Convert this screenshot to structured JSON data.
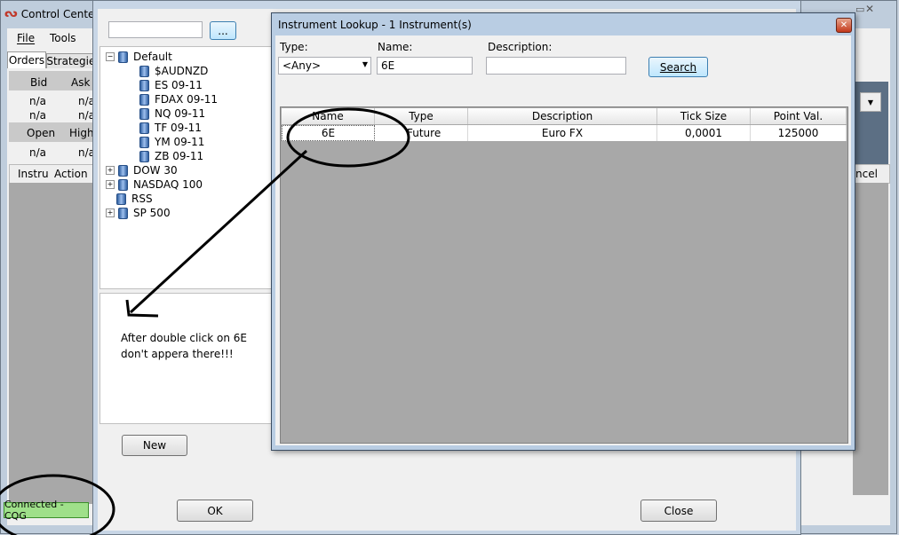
{
  "control_center": {
    "title": "Control Center",
    "menu": {
      "file": "File",
      "tools": "Tools"
    },
    "tabs": [
      "Orders",
      "Strategies"
    ],
    "quote_headers": [
      "Bid",
      "Ask"
    ],
    "quote_rows": [
      [
        "n/a",
        "n/a"
      ],
      [
        "n/a",
        "n/a"
      ]
    ],
    "quote2_headers": [
      "Open",
      "High"
    ],
    "quote2_rows": [
      [
        "n/a",
        "n/a"
      ]
    ],
    "grid_headers": [
      "Instru",
      "Action"
    ],
    "right_partial": "ncel",
    "status": "Connected - CQG"
  },
  "data_series": {
    "search_value": "",
    "browse_label": "...",
    "tree": {
      "default": "Default",
      "default_children": [
        "$AUDNZD",
        "ES 09-11",
        "FDAX 09-11",
        "NQ 09-11",
        "TF 09-11",
        "YM 09-11",
        "ZB 09-11"
      ],
      "others": [
        "DOW 30",
        "NASDAQ 100",
        "RSS",
        "SP 500"
      ]
    },
    "new_label": "New",
    "ok_label": "OK",
    "close_label": "Close"
  },
  "lookup": {
    "title": "Instrument Lookup - 1 Instrument(s)",
    "type_label": "Type:",
    "type_value": "<Any>",
    "name_label": "Name:",
    "name_value": "6E",
    "desc_label": "Description:",
    "desc_value": "",
    "search_label": "Search",
    "columns": [
      "Name",
      "Type",
      "Description",
      "Tick Size",
      "Point Val."
    ],
    "rows": [
      [
        "6E",
        "Future",
        "Euro FX",
        "0,0001",
        "125000"
      ]
    ]
  },
  "annotation": {
    "line1": "After double click on 6E",
    "line2": "don't appera there!!!"
  },
  "colors": {
    "status_bg": "#9fe08a",
    "grid_bg": "#a8a8a8",
    "title_bar": "#c8d6e6"
  }
}
